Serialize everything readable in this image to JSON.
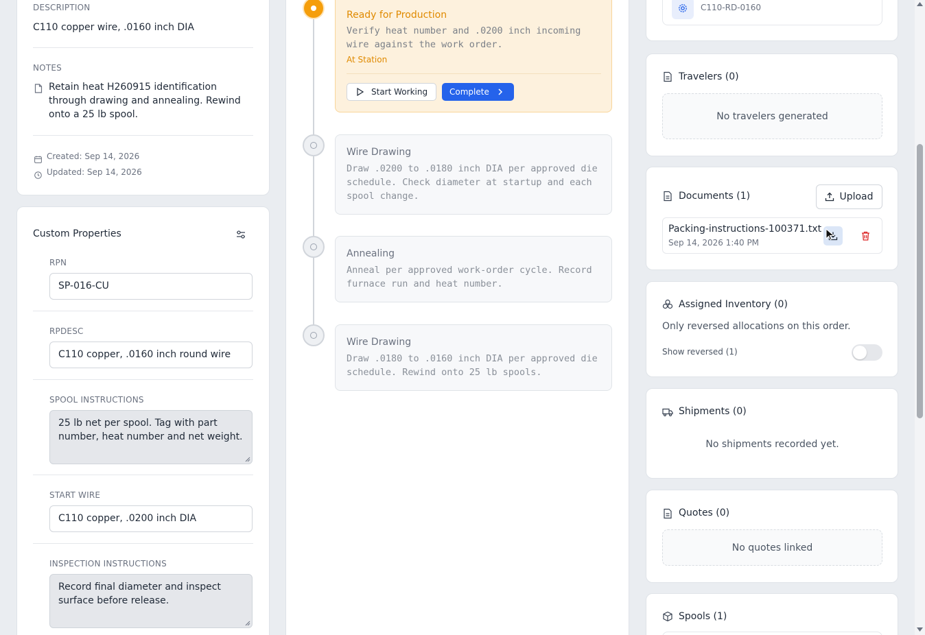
{
  "left": {
    "description_label": "DESCRIPTION",
    "description": "C110 copper wire, .0160 inch DIA",
    "notes_label": "NOTES",
    "notes": "Retain heat H260915 identification through drawing and annealing. Rewind onto a 25 lb spool.",
    "created": "Created: Sep 14, 2026",
    "updated": "Updated: Sep 14, 2026"
  },
  "custom_properties": {
    "title": "Custom Properties",
    "fields": [
      {
        "label": "RPN",
        "value": "SP-016-CU"
      },
      {
        "label": "RPDESC",
        "value": "C110 copper, .0160 inch round wire"
      },
      {
        "label": "SPOOL INSTRUCTIONS",
        "value": "25 lb net per spool. Tag with part number, heat number and net weight."
      },
      {
        "label": "START WIRE",
        "value": "C110 copper, .0200 inch DIA"
      },
      {
        "label": "INSPECTION INSTRUCTIONS",
        "value": "Record final diameter and inspect surface before release."
      }
    ]
  },
  "operations": [
    {
      "title": "Ready for Production",
      "desc": "Verify heat number and .0200 inch incoming wire against the work order.",
      "status": "At Station",
      "start_label": "Start Working",
      "complete_label": "Complete"
    },
    {
      "title": "Wire Drawing",
      "desc": "Draw .0200 to .0180 inch DIA per approved die schedule. Check diameter at startup and each spool change."
    },
    {
      "title": "Annealing",
      "desc": "Anneal per approved work-order cycle. Record furnace run and heat number."
    },
    {
      "title": "Wire Drawing",
      "desc": "Draw .0180 to .0160 inch DIA per approved die schedule. Rewind onto 25 lb spools."
    }
  ],
  "right": {
    "part_code": "C110-RD-0160",
    "travelers": {
      "title": "Travelers (0)",
      "empty": "No travelers generated"
    },
    "documents": {
      "title": "Documents (1)",
      "upload_label": "Upload",
      "file_name": "Packing-instructions-100371.txt",
      "file_date": "Sep 14, 2026 1:40 PM"
    },
    "inventory": {
      "title": "Assigned Inventory (0)",
      "text": "Only reversed allocations on this order.",
      "toggle_label": "Show reversed (1)"
    },
    "shipments": {
      "title": "Shipments (0)",
      "empty": "No shipments recorded yet."
    },
    "quotes": {
      "title": "Quotes (0)",
      "empty": "No quotes linked"
    },
    "spools": {
      "title": "Spools (1)"
    }
  },
  "colors": {
    "accent": "#2563eb",
    "warning": "#f59e0b",
    "danger": "#dc2626"
  }
}
